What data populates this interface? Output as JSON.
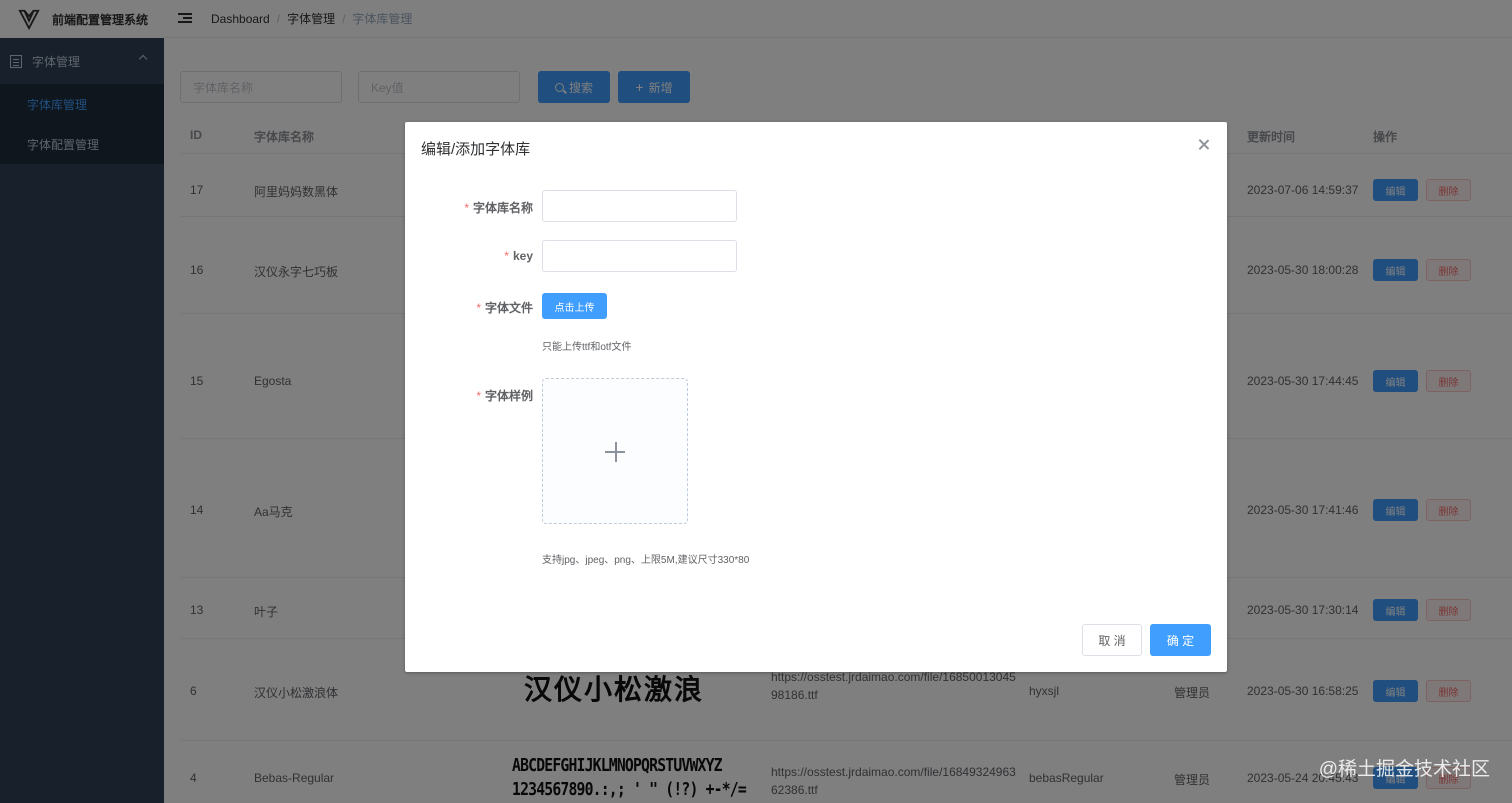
{
  "app": {
    "title": "前端配置管理系统"
  },
  "sidebar": {
    "parent_label": "字体管理",
    "items": [
      {
        "label": "字体库管理",
        "active": true
      },
      {
        "label": "字体配置管理",
        "active": false
      }
    ]
  },
  "breadcrumb": [
    "Dashboard",
    "字体管理",
    "字体库管理"
  ],
  "filters": {
    "name_placeholder": "字体库名称",
    "key_placeholder": "Key值",
    "search_label": "搜索",
    "add_label": "新增"
  },
  "table": {
    "headers": {
      "id": "ID",
      "name": "字体库名称",
      "updated": "更新时间",
      "ops": "操作"
    },
    "edit_label": "编辑",
    "delete_label": "删除",
    "rows": [
      {
        "id": "17",
        "name": "阿里妈妈数黑体",
        "updated": "2023-07-06 14:59:37",
        "url": "",
        "key": "",
        "creator": ""
      },
      {
        "id": "16",
        "name": "汉仪永字七巧板",
        "updated": "2023-05-30 18:00:28",
        "url": "",
        "key": "",
        "creator": ""
      },
      {
        "id": "15",
        "name": "Egosta",
        "updated": "2023-05-30 17:44:45",
        "url": "",
        "key": "",
        "creator": ""
      },
      {
        "id": "14",
        "name": "Aa马克",
        "updated": "2023-05-30 17:41:46",
        "url": "",
        "key": "",
        "creator": ""
      },
      {
        "id": "13",
        "name": "叶子",
        "updated": "2023-05-30 17:30:14",
        "url": "",
        "key": "",
        "creator": ""
      },
      {
        "id": "6",
        "name": "汉仪小松激浪体",
        "updated": "2023-05-30 16:58:25",
        "url": "https://osstest.jrdaimao.com/file/1685001304598186.ttf",
        "key": "hyxsjl",
        "creator": "管理员",
        "sample": "汉仪小松激浪"
      },
      {
        "id": "4",
        "name": "Bebas-Regular",
        "updated": "2023-05-24 20:45:43",
        "url": "https://osstest.jrdaimao.com/file/1684932496362386.ttf",
        "key": "bebasRegular",
        "creator": "管理员",
        "sample": "ABCDEFGHIJKLMNOPQRSTUVWXYZ",
        "sample2": "1234567890.:,; ' \" (!?) +-*/="
      }
    ]
  },
  "dialog": {
    "title": "编辑/添加字体库",
    "labels": {
      "name": "字体库名称",
      "key": "key",
      "file": "字体文件",
      "sample": "字体样例"
    },
    "upload_label": "点击上传",
    "file_tip": "只能上传ttf和otf文件",
    "image_tip": "支持jpg、jpeg、png、上限5M,建议尺寸330*80",
    "cancel_label": "取 消",
    "ok_label": "确 定"
  },
  "watermark": "@稀土掘金技术社区"
}
